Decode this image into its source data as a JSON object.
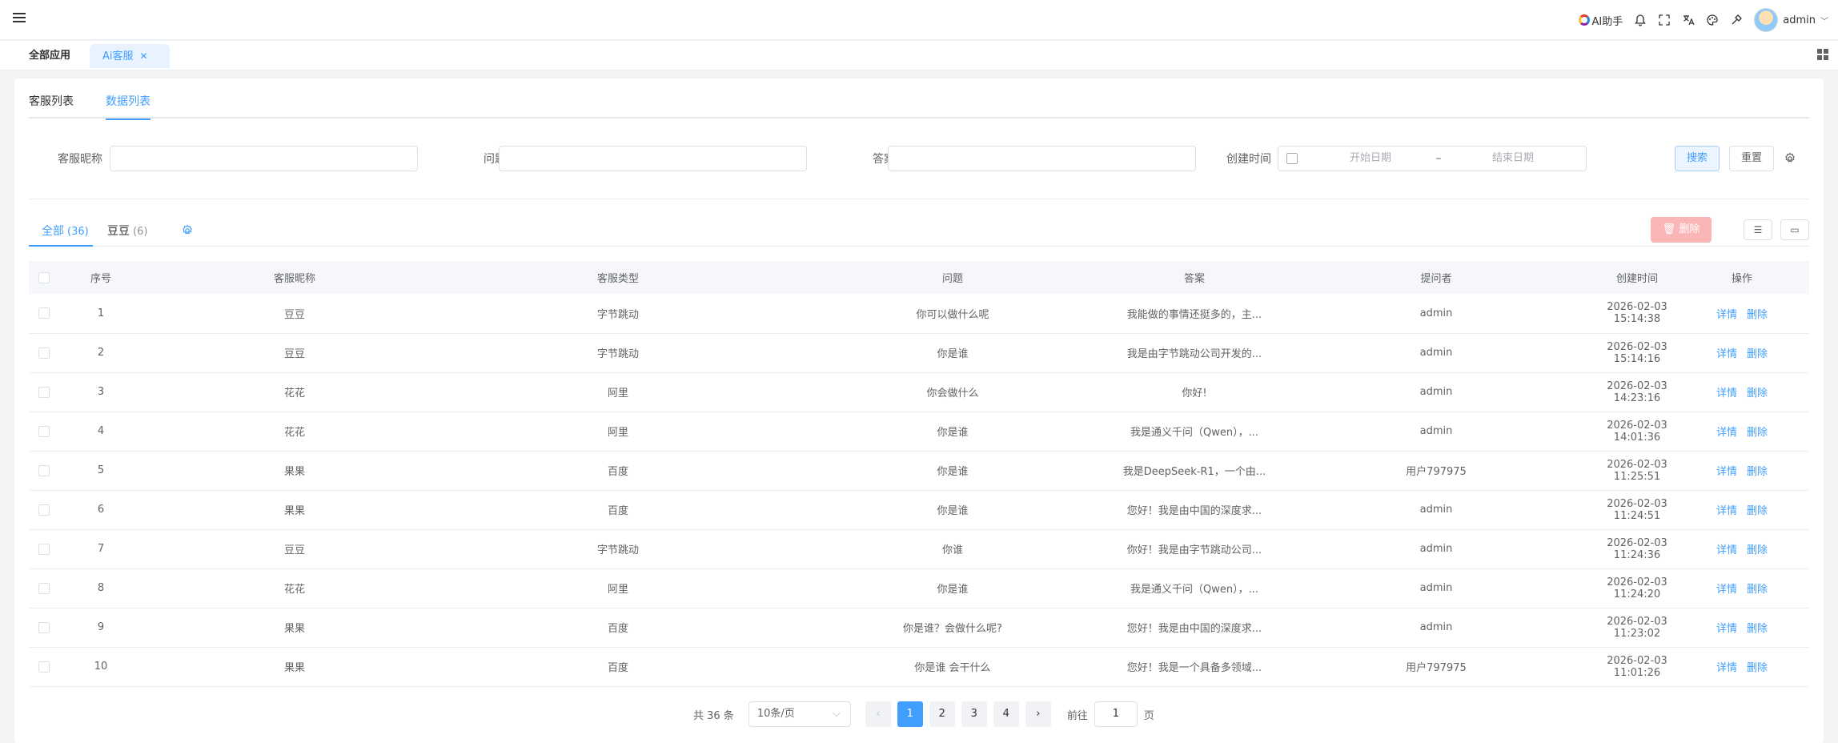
{
  "topbar": {
    "ai_helper": "AI助手",
    "user_name": "admin"
  },
  "app_tabs": [
    {
      "label": "全部应用"
    },
    {
      "label": "Ai客服"
    }
  ],
  "sub_tabs": [
    {
      "label": "客服列表"
    },
    {
      "label": "数据列表"
    }
  ],
  "filters": {
    "nickname_label": "客服昵称",
    "question_label": "问题",
    "answer_label": "答案",
    "created_label": "创建时间",
    "start_placeholder": "开始日期",
    "end_placeholder": "结束日期",
    "range_sep": "–",
    "search_button": "搜索",
    "reset_button": "重置"
  },
  "filter_tabs": [
    {
      "label": "全部",
      "count": "(36)"
    },
    {
      "label": "豆豆",
      "count": "(6)"
    }
  ],
  "toolbar": {
    "delete_button": "删除"
  },
  "table": {
    "headers": [
      "序号",
      "客服昵称",
      "客服类型",
      "问题",
      "答案",
      "提问者",
      "创建时间",
      "操作"
    ],
    "detail_label": "详情",
    "delete_label": "删除",
    "rows": [
      {
        "no": "1",
        "nick": "豆豆",
        "type": "字节跳动",
        "question": "你可以做什么呢",
        "answer": "我能做的事情还挺多的，主...",
        "asker": "admin",
        "time": "2026-02-03 15:14:38"
      },
      {
        "no": "2",
        "nick": "豆豆",
        "type": "字节跳动",
        "question": "你是谁",
        "answer": "我是由字节跳动公司开发的...",
        "asker": "admin",
        "time": "2026-02-03 15:14:16"
      },
      {
        "no": "3",
        "nick": "花花",
        "type": "阿里",
        "question": "你会做什么",
        "answer": "你好!",
        "asker": "admin",
        "time": "2026-02-03 14:23:16"
      },
      {
        "no": "4",
        "nick": "花花",
        "type": "阿里",
        "question": "你是谁",
        "answer": "我是通义千问（Qwen），...",
        "asker": "admin",
        "time": "2026-02-03 14:01:36"
      },
      {
        "no": "5",
        "nick": "果果",
        "type": "百度",
        "question": "你是谁",
        "answer": "我是DeepSeek-R1，一个由...",
        "asker": "用户797975",
        "time": "2026-02-03 11:25:51"
      },
      {
        "no": "6",
        "nick": "果果",
        "type": "百度",
        "question": "你是谁",
        "answer": "您好！我是由中国的深度求...",
        "asker": "admin",
        "time": "2026-02-03 11:24:51"
      },
      {
        "no": "7",
        "nick": "豆豆",
        "type": "字节跳动",
        "question": "你谁",
        "answer": "你好！我是由字节跳动公司...",
        "asker": "admin",
        "time": "2026-02-03 11:24:36"
      },
      {
        "no": "8",
        "nick": "花花",
        "type": "阿里",
        "question": "你是谁",
        "answer": "我是通义千问（Qwen），...",
        "asker": "admin",
        "time": "2026-02-03 11:24:20"
      },
      {
        "no": "9",
        "nick": "果果",
        "type": "百度",
        "question": "你是谁？会做什么呢?",
        "answer": "您好！我是由中国的深度求...",
        "asker": "admin",
        "time": "2026-02-03 11:23:02"
      },
      {
        "no": "10",
        "nick": "果果",
        "type": "百度",
        "question": "你是谁 会干什么",
        "answer": "您好！我是一个具备多领域...",
        "asker": "用户797975",
        "time": "2026-02-03 11:01:26"
      }
    ]
  },
  "pagination": {
    "total": "共 36 条",
    "page_size": "10条/页",
    "pages": [
      "1",
      "2",
      "3",
      "4"
    ],
    "goto_label": "前往",
    "goto_value": "1",
    "page_suffix": "页"
  }
}
